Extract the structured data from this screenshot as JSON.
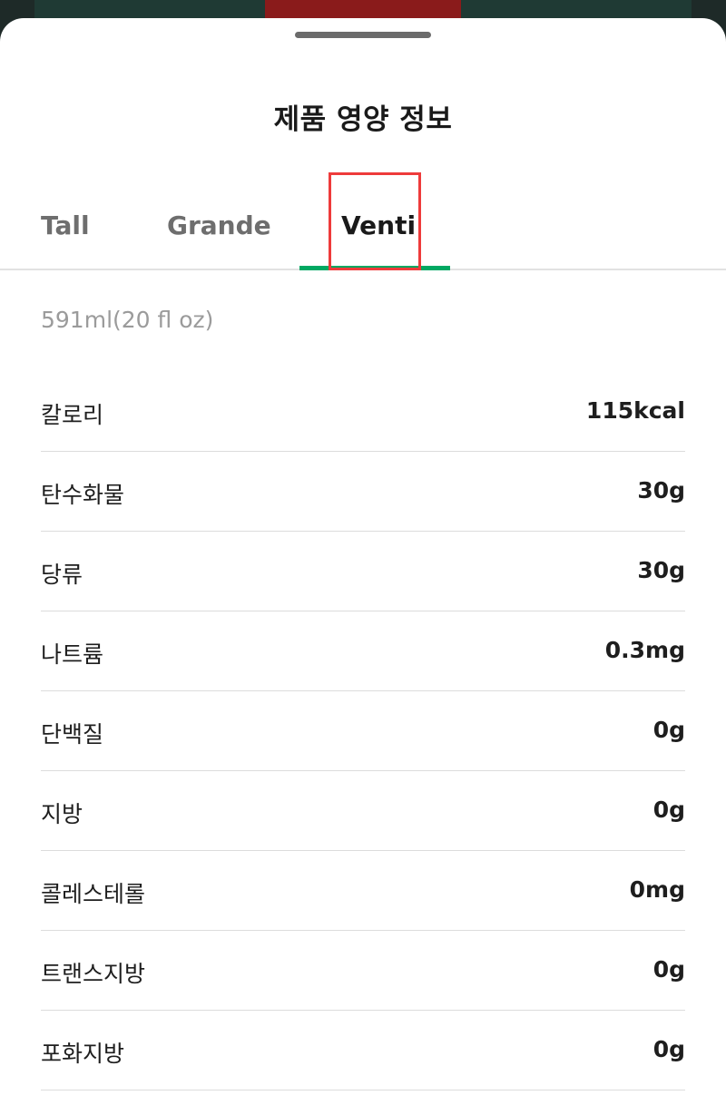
{
  "sheet": {
    "title": "제품 영양 정보"
  },
  "tabs": [
    {
      "label": "Tall",
      "selected": false
    },
    {
      "label": "Grande",
      "selected": false
    },
    {
      "label": "Venti",
      "selected": true
    }
  ],
  "size_info": "591ml(20 fl oz)",
  "nutrition": [
    {
      "label": "칼로리",
      "value": "115kcal"
    },
    {
      "label": "탄수화물",
      "value": "30g"
    },
    {
      "label": "당류",
      "value": "30g"
    },
    {
      "label": "나트륨",
      "value": "0.3mg"
    },
    {
      "label": "단백질",
      "value": "0g"
    },
    {
      "label": "지방",
      "value": "0g"
    },
    {
      "label": "콜레스테롤",
      "value": "0mg"
    },
    {
      "label": "트랜스지방",
      "value": "0g"
    },
    {
      "label": "포화지방",
      "value": "0g"
    }
  ],
  "colors": {
    "accent": "#00a862",
    "highlight": "#ee3b3b"
  }
}
